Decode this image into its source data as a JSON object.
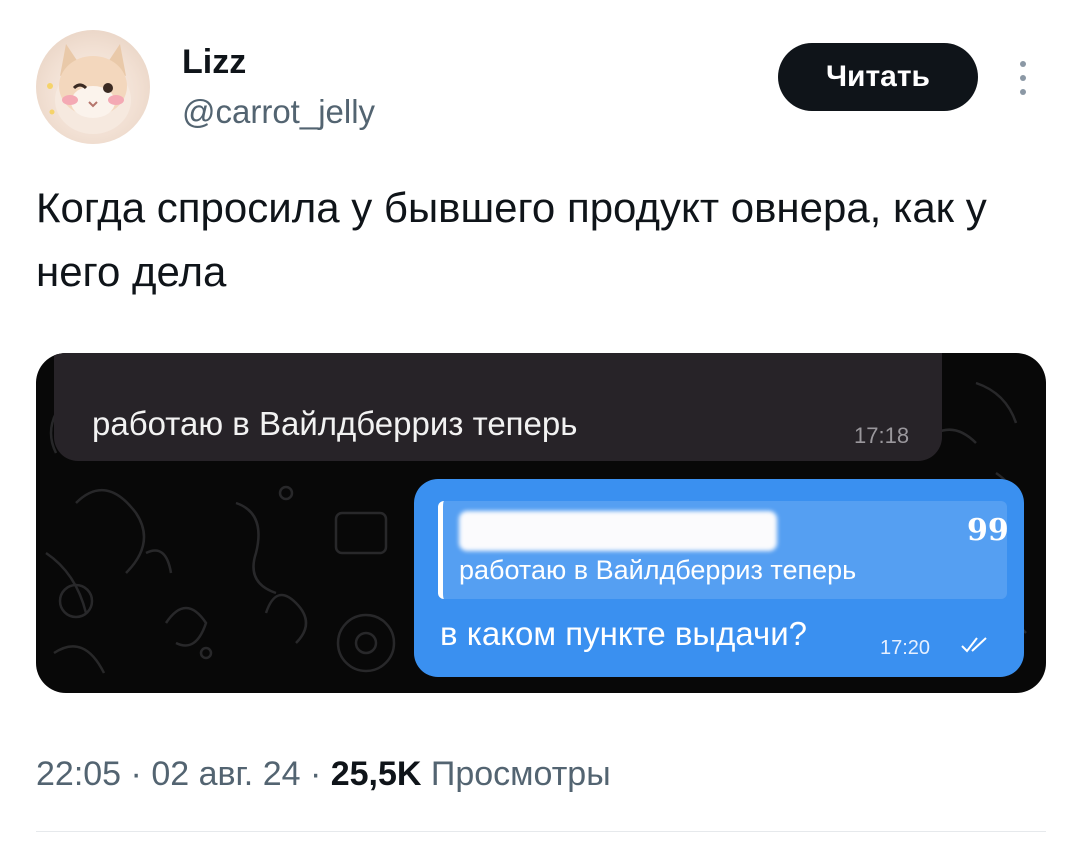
{
  "header": {
    "display_name": "Lizz",
    "handle": "@carrot_jelly",
    "follow_label": "Читать"
  },
  "tweet": {
    "text": "Когда спросила у бывшего продукт овнера, как у него дела"
  },
  "media": {
    "incoming": {
      "text": "работаю в Вайлдберриз теперь",
      "time": "17:18"
    },
    "outgoing": {
      "quote_text": "работаю в Вайлдберриз теперь",
      "quote_mark": "99",
      "text": "в каком пункте выдачи?",
      "time": "17:20"
    }
  },
  "meta": {
    "time": "22:05",
    "sep1": " · ",
    "date": "02 авг. 24",
    "sep2": " · ",
    "views_count": "25,5K",
    "views_label": " Просмотры"
  },
  "colors": {
    "button_bg": "#0f1419",
    "bubble_out": "#3a90f0",
    "bubble_in": "#272328",
    "muted": "#536471"
  }
}
